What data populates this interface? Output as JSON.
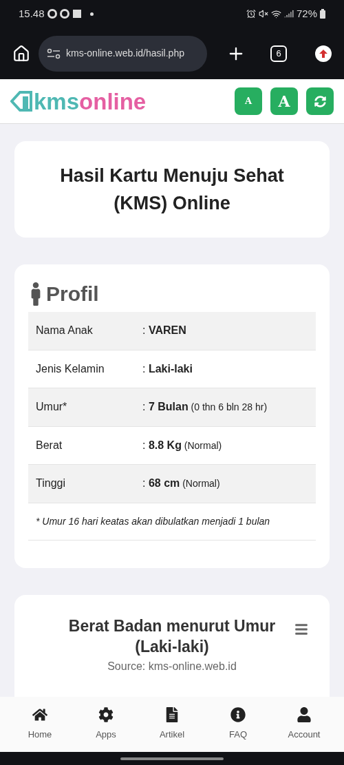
{
  "status_bar": {
    "time": "15.48",
    "battery": "72%"
  },
  "browser": {
    "url": "kms-online.web.id/hasil.php",
    "tab_count": "6"
  },
  "header": {
    "logo_left": "kms",
    "logo_right": "online",
    "buttons": [
      {
        "kind": "text-small",
        "label": "A"
      },
      {
        "kind": "text-large",
        "label": "A"
      },
      {
        "kind": "refresh"
      }
    ]
  },
  "title_card": {
    "title": "Hasil Kartu Menuju Sehat (KMS) Online"
  },
  "profile": {
    "heading": "Profil",
    "rows": [
      {
        "label": "Nama Anak",
        "separator": ":",
        "value": "VAREN"
      },
      {
        "label": "Jenis Kelamin",
        "separator": ":",
        "value": "Laki-laki"
      },
      {
        "label": "Umur*",
        "separator": ":",
        "value": "7 Bulan",
        "detail": "(0 thn 6 bln 28 hr)"
      },
      {
        "label": "Berat",
        "separator": ":",
        "value": "8.8 Kg",
        "detail": "(Normal)"
      },
      {
        "label": "Tinggi",
        "separator": ":",
        "value": "68 cm",
        "detail": "(Normal)"
      }
    ],
    "note": "* Umur 16 hari keatas akan dibulatkan menjadi 1 bulan"
  },
  "chart_card": {
    "title": "Berat Badan menurut Umur (Laki-laki)",
    "source": "Source: kms-online.web.id"
  },
  "bottom_nav": [
    {
      "kind": "home",
      "label": "Home"
    },
    {
      "kind": "apps",
      "label": "Apps"
    },
    {
      "kind": "article",
      "label": "Artikel"
    },
    {
      "kind": "faq",
      "label": "FAQ"
    },
    {
      "kind": "account",
      "label": "Account"
    }
  ]
}
